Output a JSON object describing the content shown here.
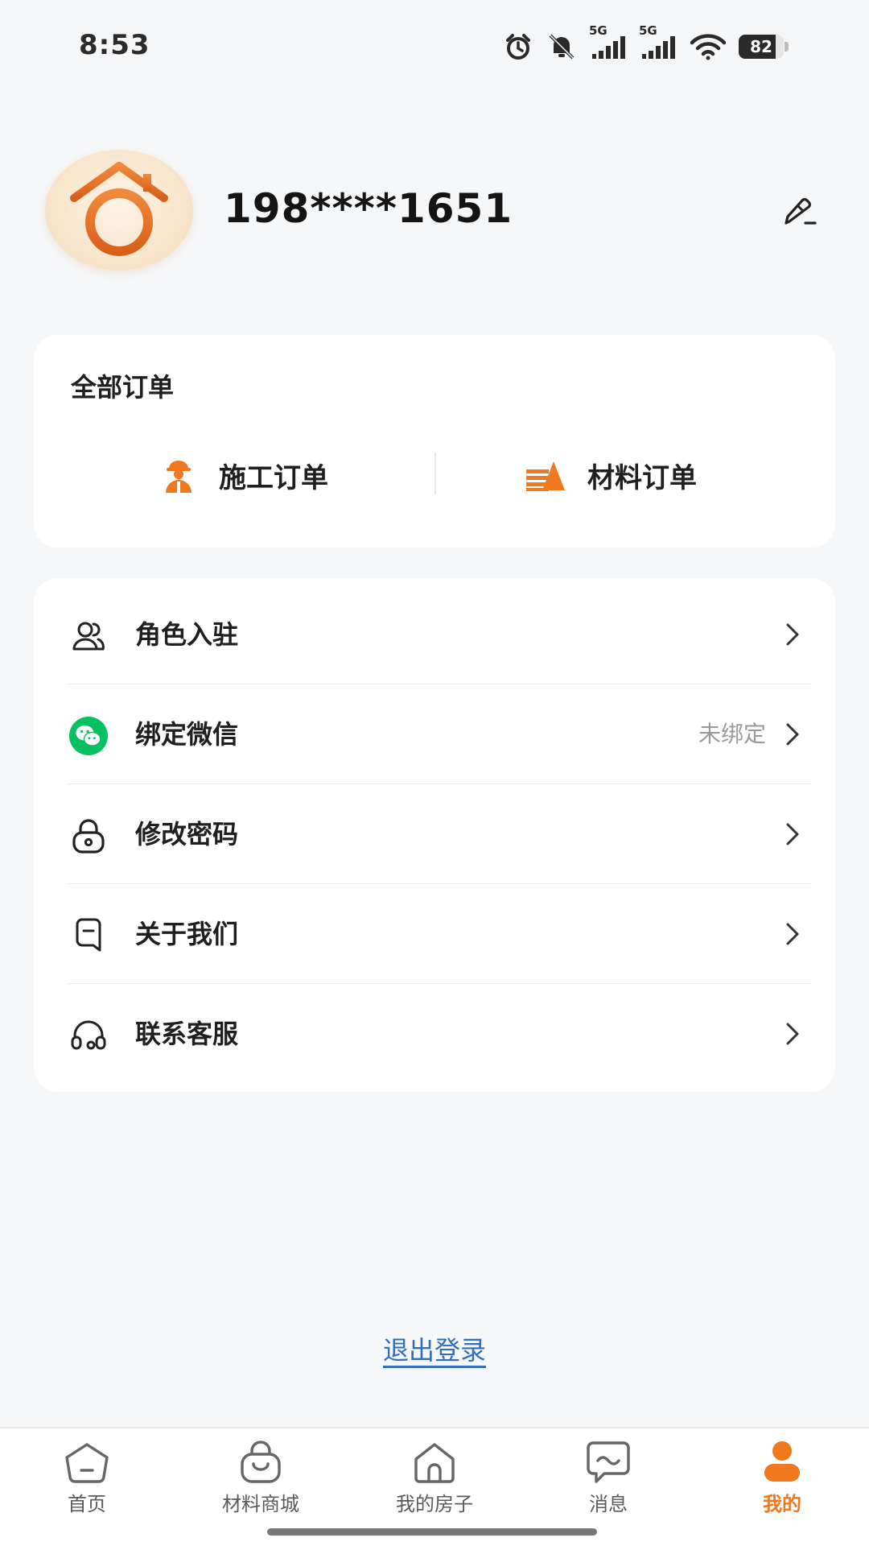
{
  "status_bar": {
    "time": "8:53",
    "battery_level": 82,
    "battery_text": "82",
    "network_1": "5G",
    "network_2": "5G",
    "icons": [
      "alarm-icon",
      "mute-icon",
      "signal-icon",
      "signal-icon",
      "wifi-icon",
      "battery-icon"
    ]
  },
  "profile": {
    "phone": "198****1651",
    "avatar_icon": "house-logo-icon",
    "edit_icon": "edit-pencil-icon"
  },
  "orders": {
    "title": "全部订单",
    "items": [
      {
        "label": "施工订单",
        "icon": "worker-icon"
      },
      {
        "label": "材料订单",
        "icon": "materials-stack-icon"
      }
    ]
  },
  "menu": {
    "items": [
      {
        "label": "角色入驻",
        "icon": "users-icon",
        "value": ""
      },
      {
        "label": "绑定微信",
        "icon": "wechat-icon",
        "value": "未绑定"
      },
      {
        "label": "修改密码",
        "icon": "lock-icon",
        "value": ""
      },
      {
        "label": "关于我们",
        "icon": "info-card-icon",
        "value": ""
      },
      {
        "label": "联系客服",
        "icon": "headset-icon",
        "value": ""
      }
    ]
  },
  "logout": {
    "label": "退出登录"
  },
  "bottom_nav": {
    "items": [
      {
        "label": "首页",
        "icon": "home-face-icon",
        "active": false
      },
      {
        "label": "材料商城",
        "icon": "shopping-bag-icon",
        "active": false
      },
      {
        "label": "我的房子",
        "icon": "house-icon",
        "active": false
      },
      {
        "label": "消息",
        "icon": "chat-icon",
        "active": false
      },
      {
        "label": "我的",
        "icon": "person-icon",
        "active": true
      }
    ]
  },
  "colors": {
    "accent": "#f0781e",
    "link": "#2f6fbd",
    "wechat": "#07c160",
    "background": "#f6f7f9"
  }
}
